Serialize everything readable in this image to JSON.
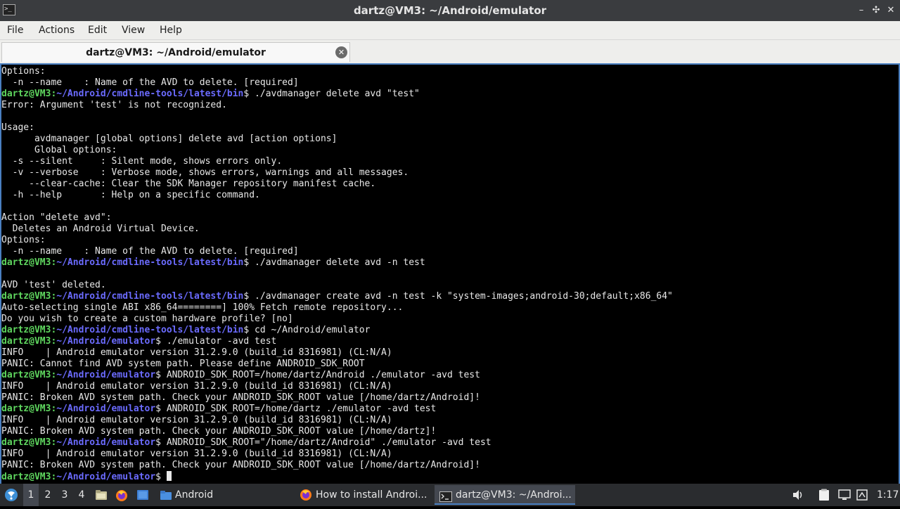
{
  "window": {
    "title": "dartz@VM3: ~/Android/emulator",
    "app_icon_glyph": ">_",
    "minimize_glyph": "–",
    "maximize_glyph": "✣",
    "close_glyph": "✕"
  },
  "menu": {
    "file": "File",
    "actions": "Actions",
    "edit": "Edit",
    "view": "View",
    "help": "Help"
  },
  "tab": {
    "label": "dartz@VM3: ~/Android/emulator",
    "close_glyph": "✕"
  },
  "terminal": {
    "user_host": "dartz@VM3:",
    "lines": [
      {
        "text": "Options:"
      },
      {
        "text": "  -n --name    : Name of the AVD to delete. [required]"
      },
      {
        "path": "~/Android/cmdline-tools/latest/bin",
        "cmd": "$ ./avdmanager delete avd \"test\""
      },
      {
        "text": "Error: Argument 'test' is not recognized."
      },
      {
        "text": ""
      },
      {
        "text": "Usage:"
      },
      {
        "text": "      avdmanager [global options] delete avd [action options]"
      },
      {
        "text": "      Global options:"
      },
      {
        "text": "  -s --silent     : Silent mode, shows errors only."
      },
      {
        "text": "  -v --verbose    : Verbose mode, shows errors, warnings and all messages."
      },
      {
        "text": "     --clear-cache: Clear the SDK Manager repository manifest cache."
      },
      {
        "text": "  -h --help       : Help on a specific command."
      },
      {
        "text": ""
      },
      {
        "text": "Action \"delete avd\":"
      },
      {
        "text": "  Deletes an Android Virtual Device."
      },
      {
        "text": "Options:"
      },
      {
        "text": "  -n --name    : Name of the AVD to delete. [required]"
      },
      {
        "path": "~/Android/cmdline-tools/latest/bin",
        "cmd": "$ ./avdmanager delete avd -n test"
      },
      {
        "text": ""
      },
      {
        "text": "AVD 'test' deleted."
      },
      {
        "path": "~/Android/cmdline-tools/latest/bin",
        "cmd": "$ ./avdmanager create avd -n test -k \"system-images;android-30;default;x86_64\""
      },
      {
        "text": "Auto-selecting single ABI x86_64========] 100% Fetch remote repository..."
      },
      {
        "text": "Do you wish to create a custom hardware profile? [no]"
      },
      {
        "path": "~/Android/cmdline-tools/latest/bin",
        "cmd": "$ cd ~/Android/emulator"
      },
      {
        "path": "~/Android/emulator",
        "cmd": "$ ./emulator -avd test"
      },
      {
        "text": "INFO    | Android emulator version 31.2.9.0 (build_id 8316981) (CL:N/A)"
      },
      {
        "text": "PANIC: Cannot find AVD system path. Please define ANDROID_SDK_ROOT"
      },
      {
        "path": "~/Android/emulator",
        "cmd": "$ ANDROID_SDK_ROOT=/home/dartz/Android ./emulator -avd test"
      },
      {
        "text": "INFO    | Android emulator version 31.2.9.0 (build_id 8316981) (CL:N/A)"
      },
      {
        "text": "PANIC: Broken AVD system path. Check your ANDROID_SDK_ROOT value [/home/dartz/Android]!"
      },
      {
        "path": "~/Android/emulator",
        "cmd": "$ ANDROID_SDK_ROOT=/home/dartz ./emulator -avd test"
      },
      {
        "text": "INFO    | Android emulator version 31.2.9.0 (build_id 8316981) (CL:N/A)"
      },
      {
        "text": "PANIC: Broken AVD system path. Check your ANDROID_SDK_ROOT value [/home/dartz]!"
      },
      {
        "path": "~/Android/emulator",
        "cmd": "$ ANDROID_SDK_ROOT=\"/home/dartz/Android\" ./emulator -avd test"
      },
      {
        "text": "INFO    | Android emulator version 31.2.9.0 (build_id 8316981) (CL:N/A)"
      },
      {
        "text": "PANIC: Broken AVD system path. Check your ANDROID_SDK_ROOT value [/home/dartz/Android]!"
      },
      {
        "path": "~/Android/emulator",
        "cmd": "$ ",
        "cursor": true
      }
    ]
  },
  "taskbar": {
    "workspaces": [
      "1",
      "2",
      "3",
      "4"
    ],
    "active_workspace": "1",
    "folder_label": "Android",
    "tasks": [
      {
        "label": "How to install Androi...",
        "icon": "firefox-icon"
      },
      {
        "label": "dartz@VM3: ~/Androi...",
        "icon": "terminal-icon"
      }
    ],
    "clock": "1:17"
  },
  "colors": {
    "prompt_user": "#5fd75f",
    "prompt_path": "#6b6bff",
    "terminal_bg": "#000000",
    "terminal_fg": "#e8e8e8",
    "accent": "#4a7fc1"
  }
}
